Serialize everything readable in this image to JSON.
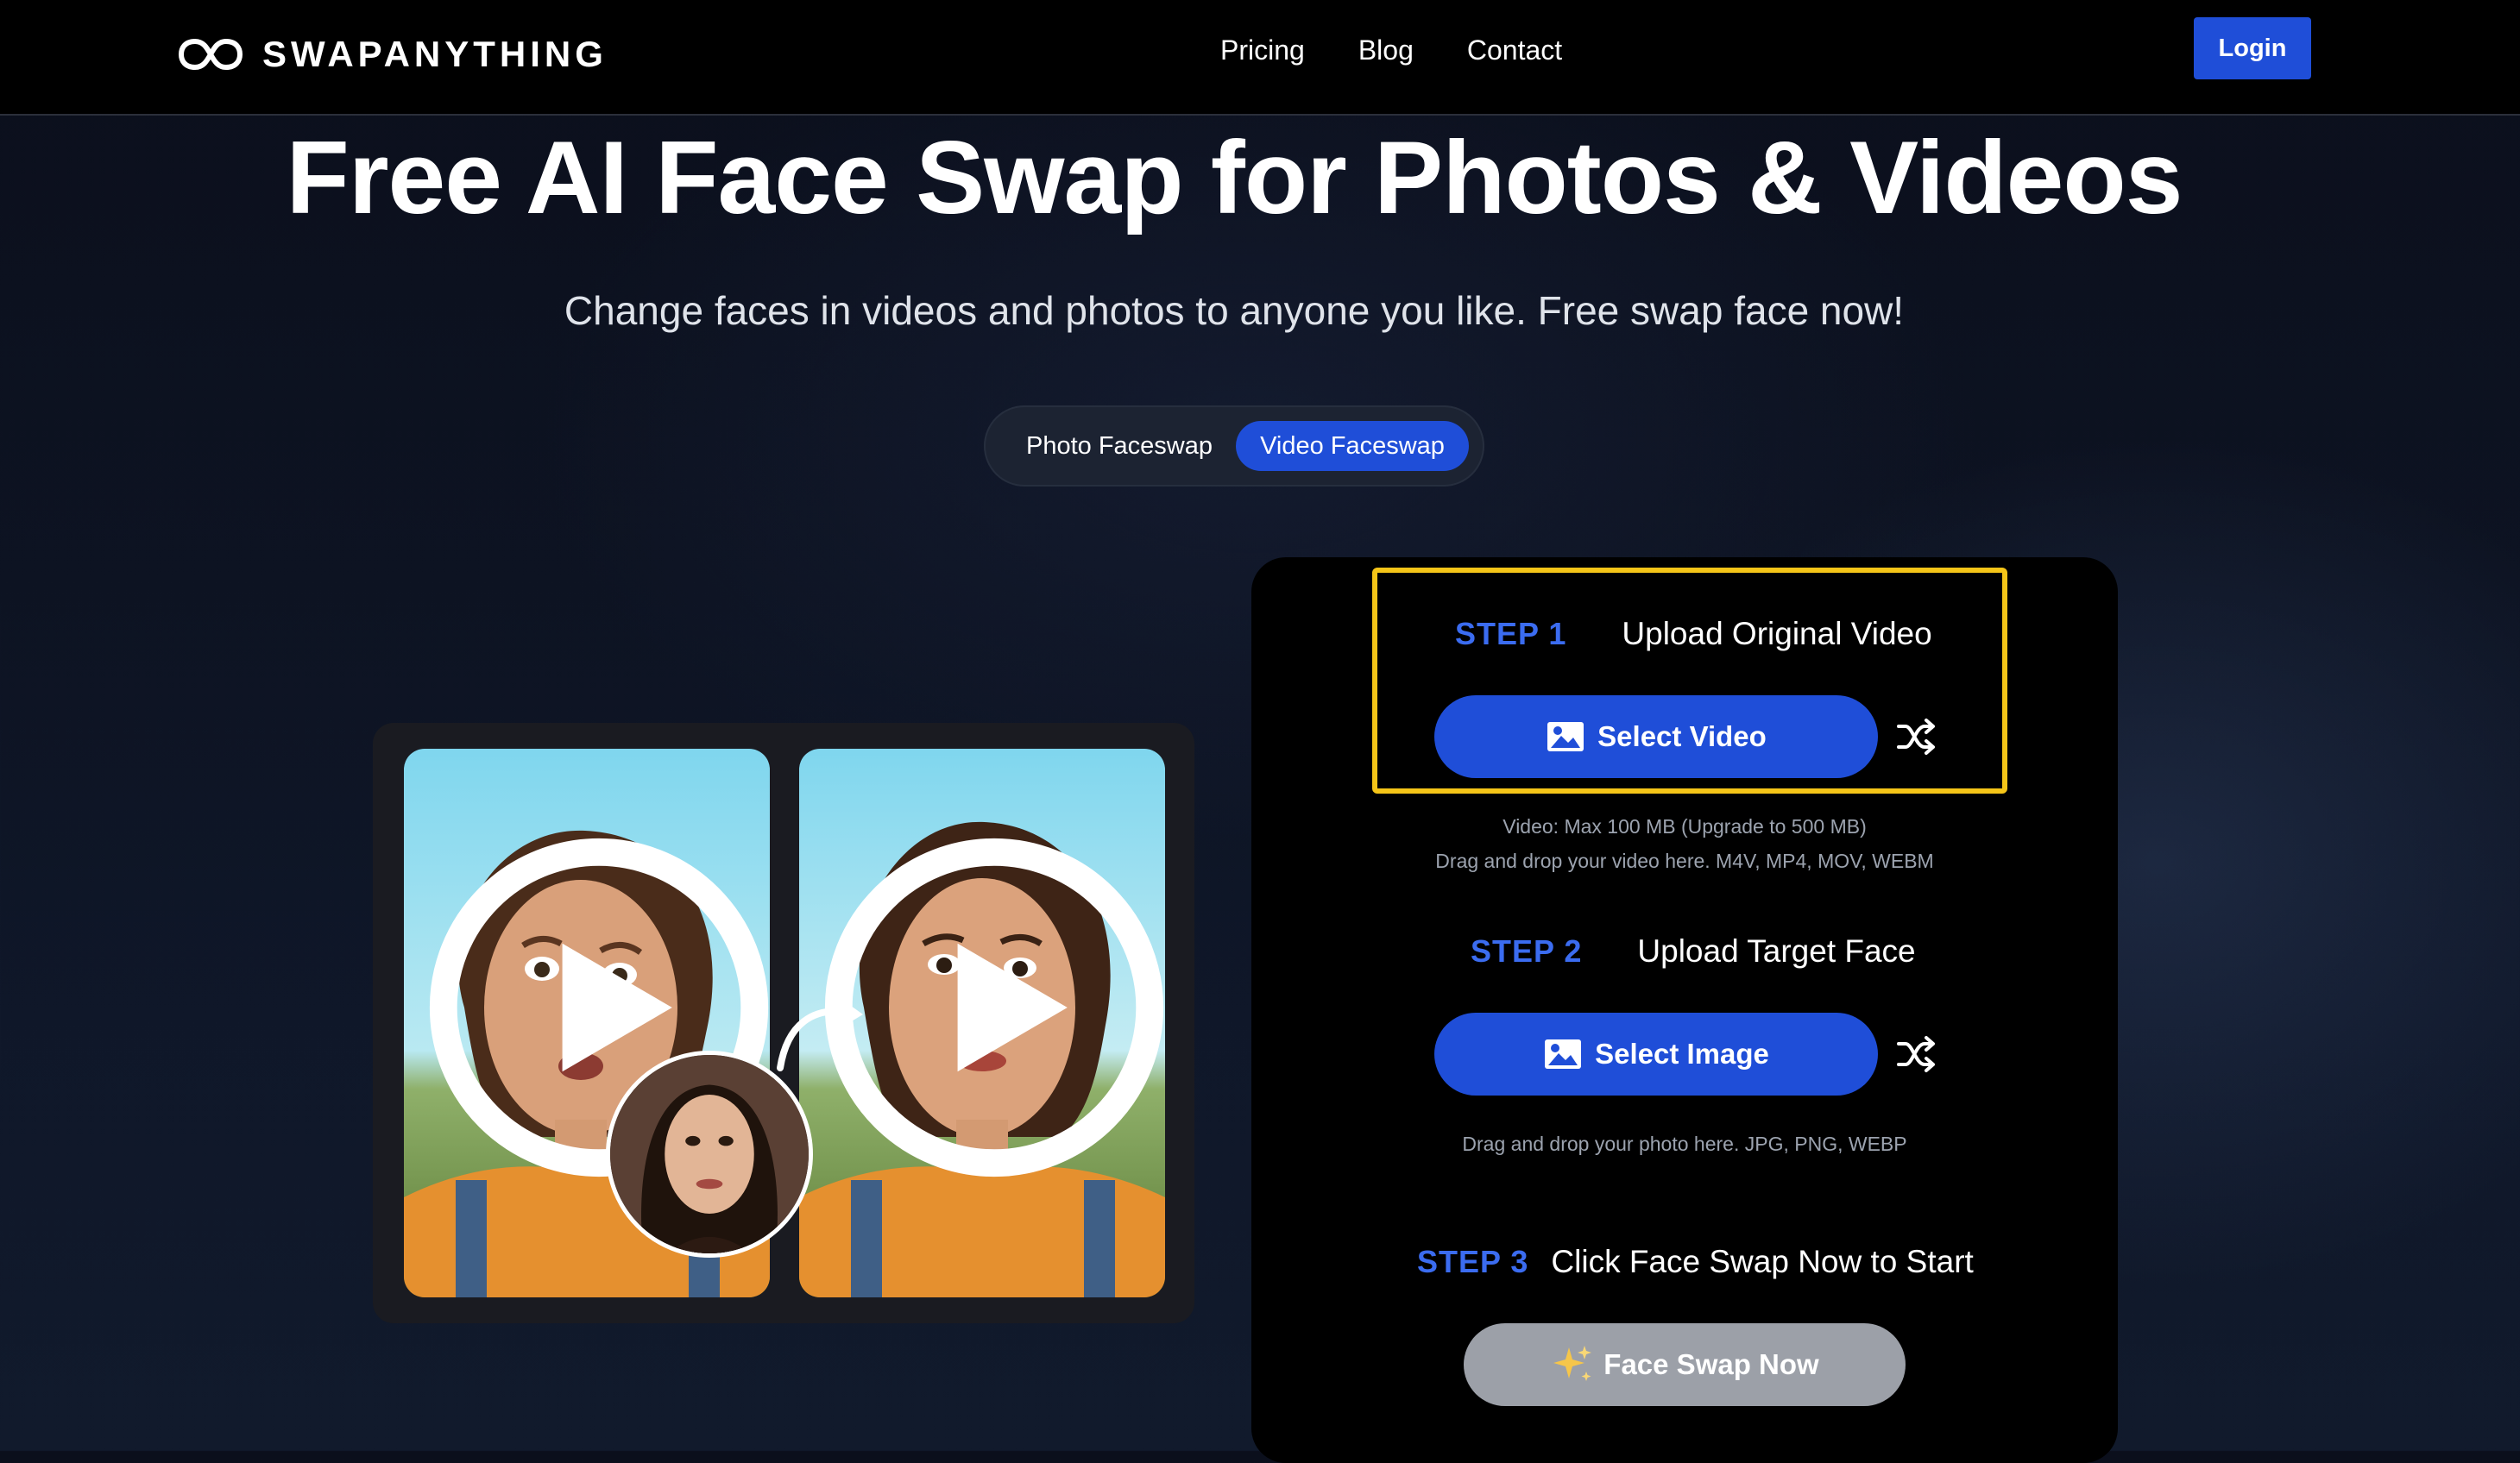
{
  "header": {
    "brand": "SWAPANYTHING",
    "nav": [
      "Pricing",
      "Blog",
      "Contact"
    ],
    "login_label": "Login"
  },
  "hero": {
    "title": "Free AI Face Swap for Photos & Videos",
    "subtitle": "Change faces in videos and photos to anyone you like. Free swap face now!"
  },
  "mode_toggle": {
    "options": [
      "Photo Faceswap",
      "Video Faceswap"
    ],
    "selected": "Video Faceswap"
  },
  "steps": [
    {
      "label": "STEP 1",
      "title": "Upload Original Video",
      "button": "Select Video",
      "hints": [
        "Video: Max 100 MB (Upgrade to 500 MB)",
        "Drag and drop your video here. M4V, MP4, MOV, WEBM"
      ]
    },
    {
      "label": "STEP 2",
      "title": "Upload Target Face",
      "button": "Select Image",
      "hints": [
        "Drag and drop your photo here. JPG, PNG, WEBP"
      ]
    },
    {
      "label": "STEP 3",
      "title": "Click Face Swap Now to Start",
      "button": "Face Swap Now"
    }
  ],
  "icons": {
    "logo": "infinity-logo-icon",
    "select": "image-icon",
    "shuffle": "shuffle-icon",
    "sparkle": "sparkle-icon",
    "play": "play-icon"
  },
  "colors": {
    "accent": "#1f4ed8",
    "step_label": "#3b6cf0",
    "highlight": "#f5c518",
    "disabled_button": "#9ca0a8"
  }
}
